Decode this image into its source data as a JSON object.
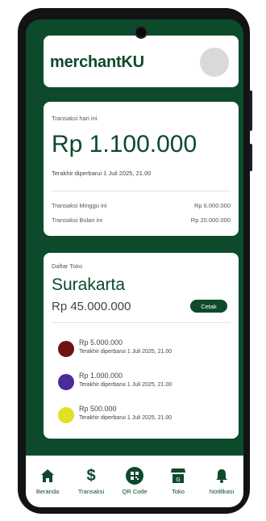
{
  "header": {
    "brand": "merchantKU"
  },
  "today": {
    "label": "Transaksi hari ini",
    "amount": "Rp 1.100.000",
    "updated": "Terakhir diperbarui 1 Juli 2025, 21.00",
    "rows": [
      {
        "label": "Transaksi Minggu ini",
        "value": "Rp 6.000.000"
      },
      {
        "label": "Transaksi Bulan ini",
        "value": "Rp 20.000.000"
      }
    ]
  },
  "store": {
    "label": "Daftar Toko",
    "city": "Surakarta",
    "total": "Rp 45.000.000",
    "print_label": "Cetak",
    "items": [
      {
        "amount": "Rp 5.000.000",
        "updated": "Terakhir diperbarui 1 Juli 2025, 21.00",
        "color": "#6b1414"
      },
      {
        "amount": "Rp 1.000.000",
        "updated": "Terakhir diperbarui 1 Juli 2025, 21.00",
        "color": "#4b2a9a"
      },
      {
        "amount": "Rp 500.000",
        "updated": "Terakhir diperbarui 1 Juli 2025, 21.00",
        "color": "#e0e024"
      }
    ]
  },
  "nav": [
    {
      "label": "Beranda",
      "icon": "home-icon"
    },
    {
      "label": "Transaksi",
      "icon": "dollar-icon"
    },
    {
      "label": "QR Code",
      "icon": "qr-icon"
    },
    {
      "label": "Toko",
      "icon": "store-icon"
    },
    {
      "label": "Notifikasi",
      "icon": "bell-icon"
    }
  ],
  "colors": {
    "primary": "#0d4a2b",
    "card": "#ffffff",
    "avatar": "#d9d9d9"
  }
}
